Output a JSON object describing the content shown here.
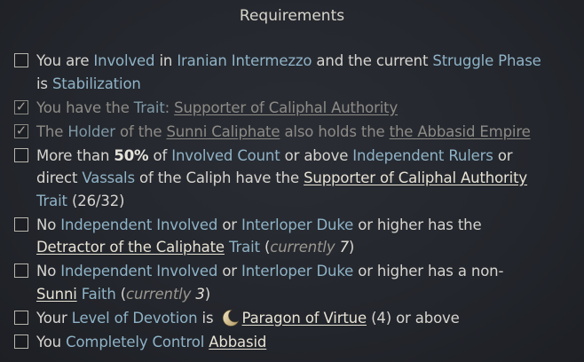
{
  "title": "Requirements",
  "requirements": [
    {
      "t1": "You are ",
      "k1": "Involved",
      "t2": " in ",
      "k2": "Iranian Intermezzo",
      "t3": " and the current ",
      "k3": "Struggle Phase",
      "t4": "is ",
      "k4": "Stabilization"
    },
    {
      "t1": "You have the ",
      "k1": "Trait",
      "t2": ": ",
      "l1": "Supporter of Caliphal Authority"
    },
    {
      "t1": "The ",
      "k1": "Holder",
      "t2": " of the ",
      "l1": "Sunni Caliphate",
      "t3": " also holds the ",
      "l2": "the Abbasid Empire"
    },
    {
      "t1": "More than ",
      "b1": "50%",
      "t2": " of ",
      "k1": "Involved",
      "t3": " ",
      "k2": "Count",
      "t4": " or above ",
      "k3": "Independent",
      "t5": " ",
      "k4": "Rulers",
      "t6": " or",
      "t7": "direct ",
      "k5": "Vassals",
      "t8": " of the Caliph have the ",
      "l1": "Supporter of Caliphal Authority",
      "k6": "Trait",
      "t9": " (26/32)"
    },
    {
      "t1": "No ",
      "k1": "Independent",
      "t2": " ",
      "k2": "Involved",
      "t3": " or ",
      "k3": "Interloper",
      "t4": " ",
      "k4": "Duke",
      "t5": " or higher has the",
      "l1": "Detractor of the Caliphate",
      "t6": " ",
      "k5": "Trait",
      "t7": " (",
      "e1": "currently ",
      "e2": "7",
      "t8": ")"
    },
    {
      "t1": "No ",
      "k1": "Independent",
      "t2": " ",
      "k2": "Involved",
      "t3": " or ",
      "k3": "Interloper",
      "t4": " ",
      "k4": "Duke",
      "t5": " or higher has a non-",
      "l1": "Sunni",
      "t6": " ",
      "k5": "Faith",
      "t7": " (",
      "e1": "currently ",
      "e2": "3",
      "t8": ")"
    },
    {
      "t1": "Your ",
      "k1": "Level of Devotion",
      "t2": " is ",
      "icon": "crescent-moon-icon",
      "l1": "Paragon of Virtue",
      "t3": " (4) or above"
    },
    {
      "t1": "You ",
      "k1": "Completely Control",
      "t2": " ",
      "l1": "Abbasid"
    }
  ],
  "states": [
    "unchecked",
    "checked",
    "checked",
    "unchecked",
    "unchecked",
    "unchecked",
    "unchecked",
    "unchecked"
  ],
  "colors": {
    "keyword": "#8fb3c7",
    "link": "#e7e2d4",
    "met_text": "#8d8b86",
    "background": "#23262c"
  }
}
